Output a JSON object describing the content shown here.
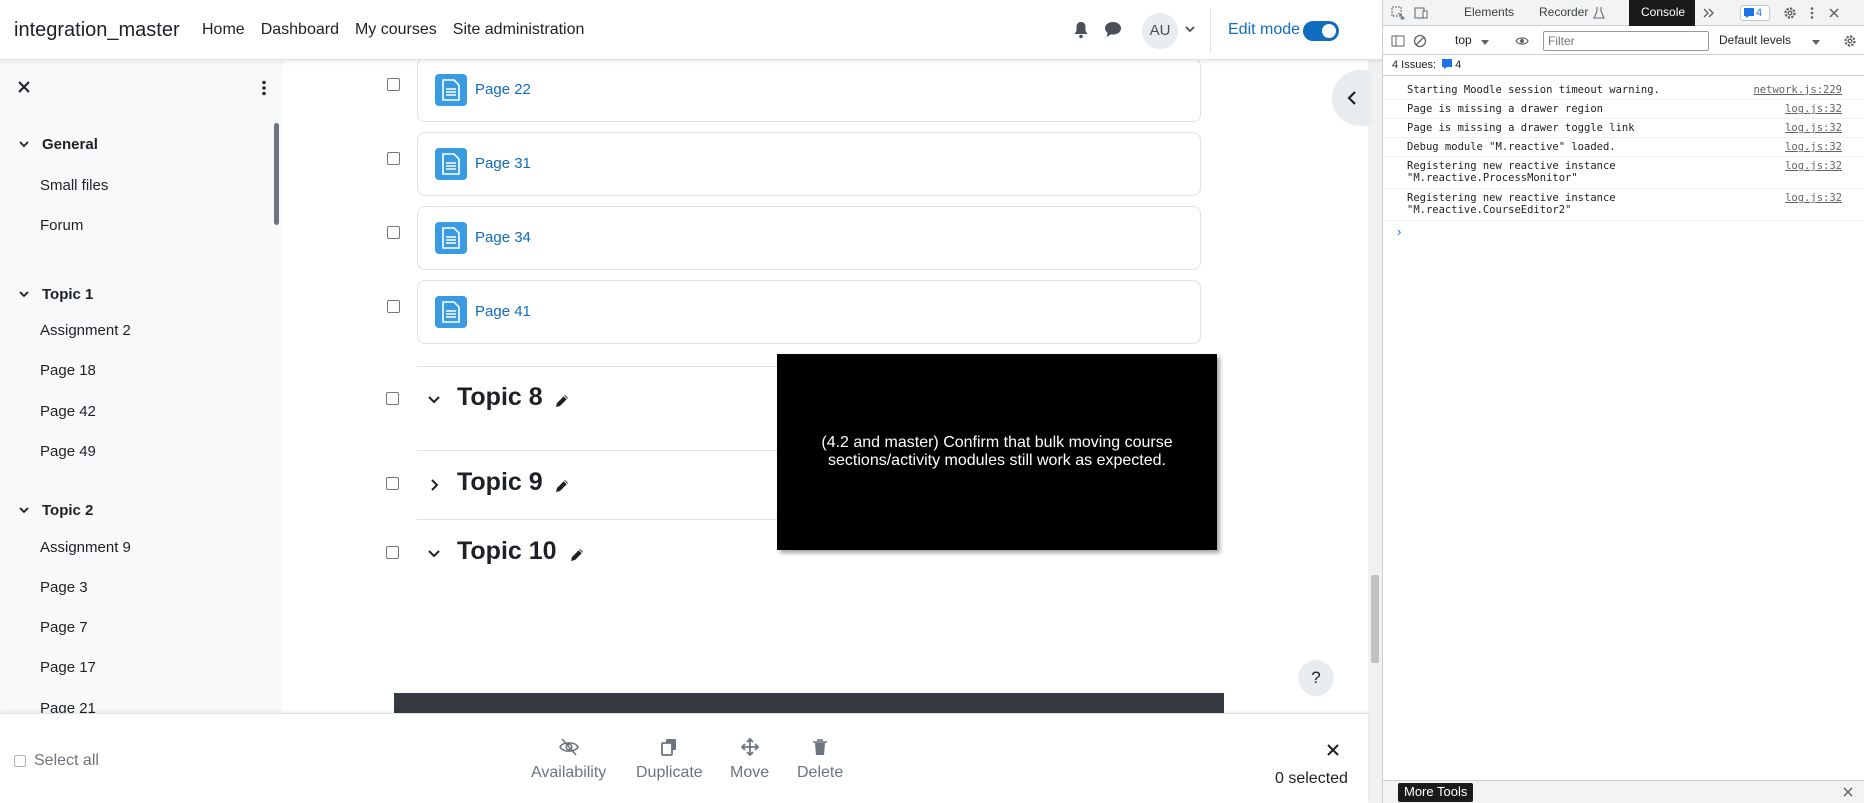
{
  "navbar": {
    "site_name": "integration_master",
    "links": [
      "Home",
      "Dashboard",
      "My courses",
      "Site administration"
    ],
    "avatar_initials": "AU",
    "edit_mode_label": "Edit mode",
    "edit_mode_on": true
  },
  "drawer": {
    "sections": [
      {
        "title": "General",
        "items": [
          "Small files",
          "Forum"
        ]
      },
      {
        "title": "Topic 1",
        "items": [
          "Assignment 2",
          "Page 18",
          "Page 42",
          "Page 49"
        ]
      },
      {
        "title": "Topic 2",
        "items": [
          "Assignment 9",
          "Page 3",
          "Page 7",
          "Page 17",
          "Page 21"
        ]
      }
    ]
  },
  "main": {
    "activities": [
      "Page 22",
      "Page 31",
      "Page 34",
      "Page 41"
    ],
    "topics": [
      {
        "title": "Topic 8",
        "expanded": true
      },
      {
        "title": "Topic 9",
        "expanded": false
      },
      {
        "title": "Topic 10",
        "expanded": true
      }
    ],
    "tooltip": "(4.2 and master) Confirm that bulk moving course sections/activity modules still work as expected.",
    "help_label": "?"
  },
  "bulk_bar": {
    "select_all": "Select all",
    "actions": [
      "Availability",
      "Duplicate",
      "Move",
      "Delete"
    ],
    "selected_count": "0 selected"
  },
  "devtools": {
    "tabs": [
      "Elements",
      "Recorder",
      "Console"
    ],
    "active_tab": "Console",
    "badge_count": "4",
    "context": "top",
    "filter_placeholder": "Filter",
    "levels": "Default levels",
    "issues": "4 Issues:",
    "issues_count": "4",
    "logs": [
      {
        "msg": "Starting Moodle session timeout warning.",
        "src": "network.js:229"
      },
      {
        "msg": "Page is missing a drawer region",
        "src": "log.js:32"
      },
      {
        "msg": "Page is missing a drawer toggle link",
        "src": "log.js:32"
      },
      {
        "msg": "Debug module \"M.reactive\" loaded.",
        "src": "log.js:32"
      },
      {
        "msg": "Registering new reactive instance\n\"M.reactive.ProcessMonitor\"",
        "src": "log.js:32"
      },
      {
        "msg": "Registering new reactive instance\n\"M.reactive.CourseEditor2\"",
        "src": "log.js:32"
      }
    ],
    "prompt": "›",
    "more_tools": "More Tools"
  },
  "colors": {
    "brand": "#0f6cbf",
    "activity_icon": "#399be2",
    "tooltip_bg": "#000000"
  }
}
